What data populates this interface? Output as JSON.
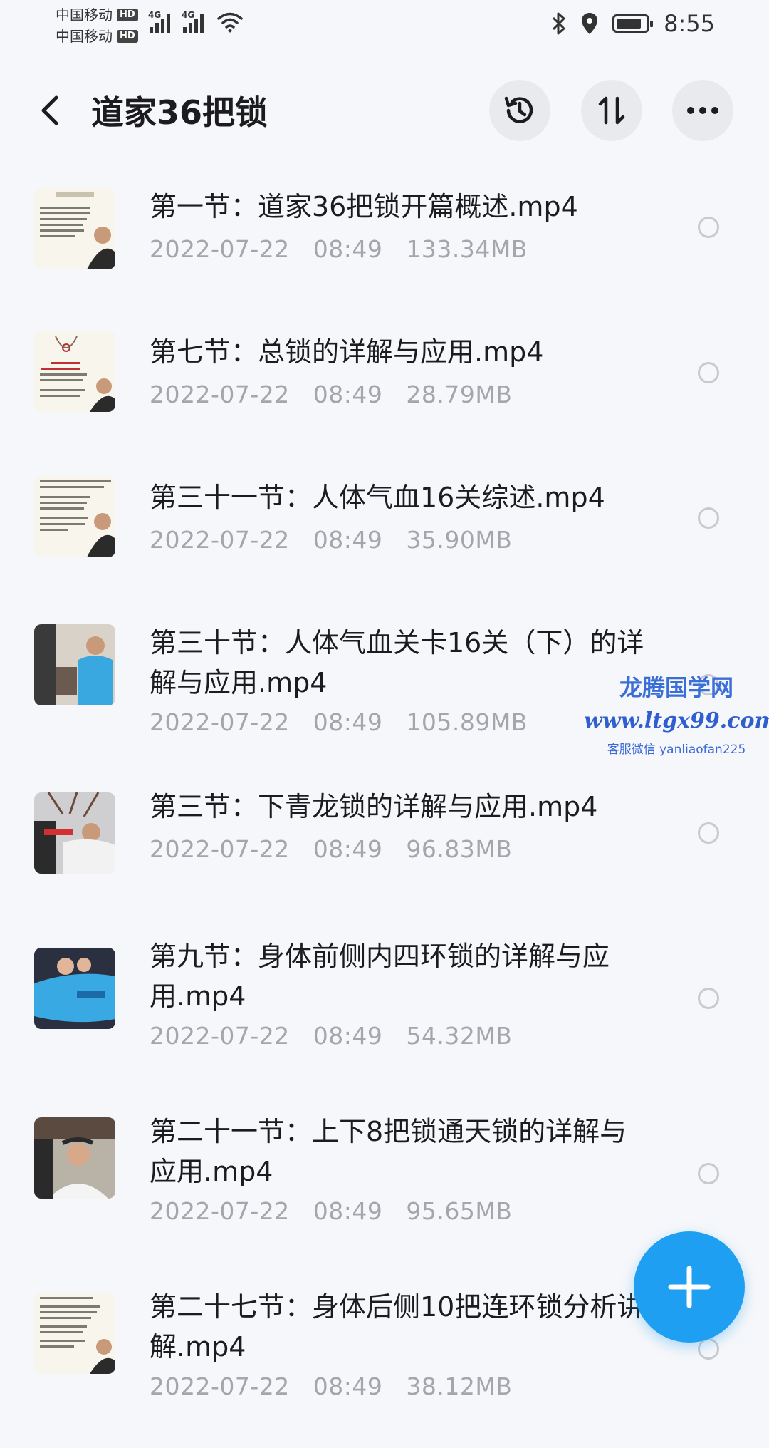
{
  "status_bar": {
    "carrier_1": "中国移动",
    "carrier_2": "中国移动",
    "hd": "HD",
    "net_type": "4G",
    "time": "8:55",
    "battery_level": 0.85
  },
  "header": {
    "title": "道家36把锁"
  },
  "files": [
    {
      "name": "第一节：道家36把锁开篇概述.mp4",
      "date": "2022-07-22",
      "time": "08:49",
      "size": "133.34MB"
    },
    {
      "name": "第七节：总锁的详解与应用.mp4",
      "date": "2022-07-22",
      "time": "08:49",
      "size": "28.79MB"
    },
    {
      "name": "第三十一节：人体气血16关综述.mp4",
      "date": "2022-07-22",
      "time": "08:49",
      "size": "35.90MB"
    },
    {
      "name": "第三十节：人体气血关卡16关（下）的详解与应用.mp4",
      "date": "2022-07-22",
      "time": "08:49",
      "size": "105.89MB"
    },
    {
      "name": "第三节：下青龙锁的详解与应用.mp4",
      "date": "2022-07-22",
      "time": "08:49",
      "size": "96.83MB"
    },
    {
      "name": "第九节：身体前侧内四环锁的详解与应用.mp4",
      "date": "2022-07-22",
      "time": "08:49",
      "size": "54.32MB"
    },
    {
      "name": "第二十一节：上下8把锁通天锁的详解与应用.mp4",
      "date": "2022-07-22",
      "time": "08:49",
      "size": "95.65MB"
    },
    {
      "name": "第二十七节：身体后侧10把连环锁分析讲解.mp4",
      "date": "2022-07-22",
      "time": "08:49",
      "size": "38.12MB"
    }
  ],
  "watermark": {
    "line1": "龙腾国学网",
    "line2": "www.ltgx99.com",
    "line3": "客服微信 yanliaofan225"
  },
  "colors": {
    "accent": "#1e9ff2",
    "meta_text": "#a4a6ab",
    "background": "#f6f7fa"
  }
}
